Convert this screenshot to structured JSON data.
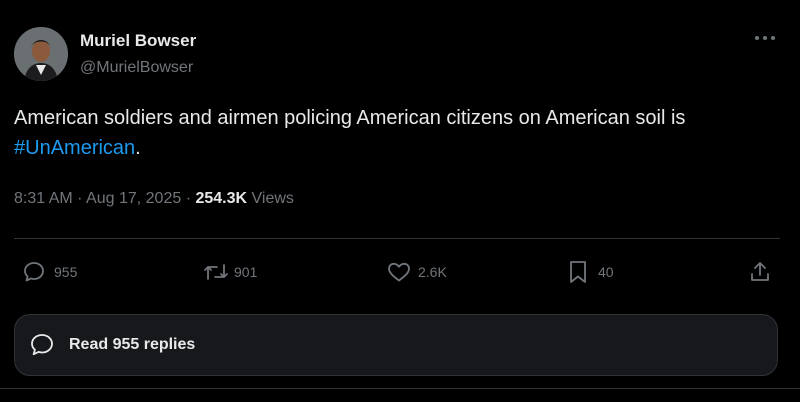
{
  "author": {
    "name": "Muriel Bowser",
    "handle": "@MurielBowser"
  },
  "tweet": {
    "text": "American soldiers and airmen policing American citizens on American soil is ",
    "hashtag": "#UnAmerican",
    "end_punct": "."
  },
  "meta": {
    "time": "8:31 AM",
    "separator1": " · ",
    "date": "Aug 17, 2025",
    "separator2": " · ",
    "views_count": "254.3K",
    "views_label": " Views"
  },
  "actions": {
    "replies": "955",
    "reposts": "901",
    "likes": "2.6K",
    "bookmarks": "40"
  },
  "read_replies_label": "Read 955 replies",
  "icons": {
    "more": "more-horizontal-icon",
    "reply": "reply-bubble-icon",
    "repost": "repost-icon",
    "like": "heart-icon",
    "bookmark": "bookmark-icon",
    "share": "share-icon"
  },
  "colors": {
    "background": "#000000",
    "text": "#e7e9ea",
    "muted": "#71767b",
    "link": "#1d9bf0",
    "border": "#2f3336"
  }
}
